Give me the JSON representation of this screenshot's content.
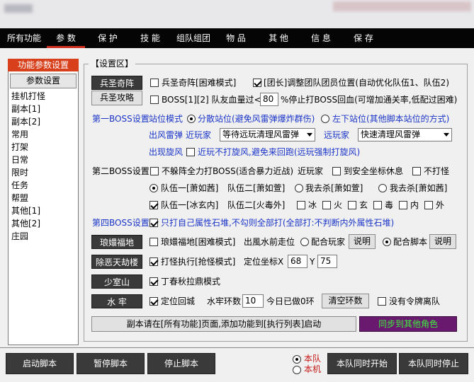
{
  "tabs": [
    "所有功能",
    "参 数",
    "保 护",
    "技 能",
    "组队组团",
    "物 品",
    "其 他",
    "信 息",
    "保 存"
  ],
  "sidebar": {
    "title": "功能参数设置",
    "button": "参数设置",
    "items": [
      "挂机打怪",
      "副本[1]",
      "副本[2]",
      "常用",
      "打架",
      "日常",
      "限时",
      "任务",
      "帮盟",
      "其他[1]",
      "其他[2]",
      "庄园"
    ]
  },
  "settings": {
    "group_title": "【设置区】",
    "btn_bsqz": "兵圣奇阵",
    "cb_bsqz": "兵圣奇阵[困难模式]",
    "cb_team_adjust": "[团长]调整团队团员位置(自动优化队伍1、队伍2)",
    "btn_bsgl": "兵圣攻略",
    "cb_boss12": "BOSS[1][2] 队友血量过<",
    "hp_value": "80",
    "hp_suffix": "%停止打BOSS回血(可增加通关率,低配过困难)",
    "boss1_label": "第一BOSS设置",
    "pos_mode": "站位模式",
    "r_scatter": "分散站位(避免风雷弹爆炸群伤)",
    "r_leftdown": "左下站位(其他脚本站位的方式)",
    "fld_label": "出风雷弹",
    "near_player": "近玩家",
    "fld_select1": "等待远玩清理风雷弹",
    "far_player": "远玩家",
    "fld_select2": "快速清理风雷弹",
    "xfeng_label": "出现旋风",
    "cb_near_no_xfeng": "近玩不打旋风,避免来回跑(远玩强制打旋风)",
    "boss2_label": "第二BOSS设置",
    "cb_no_dodge": "不躲阵全力打BOSS(适合暴力近战)",
    "near_player2": "近玩家",
    "cb_safe_rest": "到安全坐标休息",
    "cb_no_hit": "不打怪",
    "r_team1_mrq": "队伍一[萧如茜]",
    "team2_mrx": "队伍二[萧如萱]",
    "r_kill_mrx": "我去杀[萧如萱]",
    "r_kill_mrq": "我去杀[萧如茜]",
    "cb_team1_bxn": "队伍一[冰玄内]",
    "team2_hdw": "队伍二[火毒外]",
    "cb_bing": "冰",
    "cb_huo": "火",
    "cb_xuan": "玄",
    "cb_du": "毒",
    "cb_nei": "内",
    "cb_wai": "外",
    "boss4_label": "第四BOSS设置",
    "cb_own_attr": "只打自己属性石堆,不勾则全部打(全部打:不判断内外属性石堆)",
    "btn_lhfd": "琅嬛福地",
    "cb_lhfd": "琅嬛福地[困难模式]",
    "exit_walk": "出風水前走位",
    "r_cooperate_player": "配合玩家",
    "btn_explain1": "说明",
    "r_cooperate_script": "配合脚本",
    "btn_explain2": "说明",
    "btn_ceft": "除恶天劫楼",
    "cb_hit_exec": "打怪执行[抢怪模式]",
    "pos_coord": "定位坐标X",
    "coord_x": "68",
    "coord_y_label": "Y",
    "coord_y": "75",
    "btn_sss": "少室山",
    "cb_dingchun": "丁春秋拉鼎模式",
    "btn_shuilao": "水 牢",
    "cb_return_city": "定位回城",
    "shuilao_rounds": "水牢环数",
    "rounds_value": "10",
    "done_today": "今日已做0环",
    "btn_clear_rounds": "清空环数",
    "cb_no_token": "没有令牌离队",
    "notice_btn": "副本请在[所有功能]页面,添加功能到[执行列表]启动",
    "sync_btn": "同步到其他角色"
  },
  "bottom": {
    "start": "启动脚本",
    "pause": "暂停脚本",
    "stop": "停止脚本",
    "r_this_team": "本队",
    "r_this_pc": "本机",
    "team_start": "本队同时开始",
    "team_stop": "本队同时停止"
  },
  "colors": {
    "accent_red": "#d8401c",
    "dark_btn": "#3a3a3a",
    "purple": "#6a1a6e",
    "sync_text": "#3cf03c",
    "blue_text": "#1b35c8"
  }
}
